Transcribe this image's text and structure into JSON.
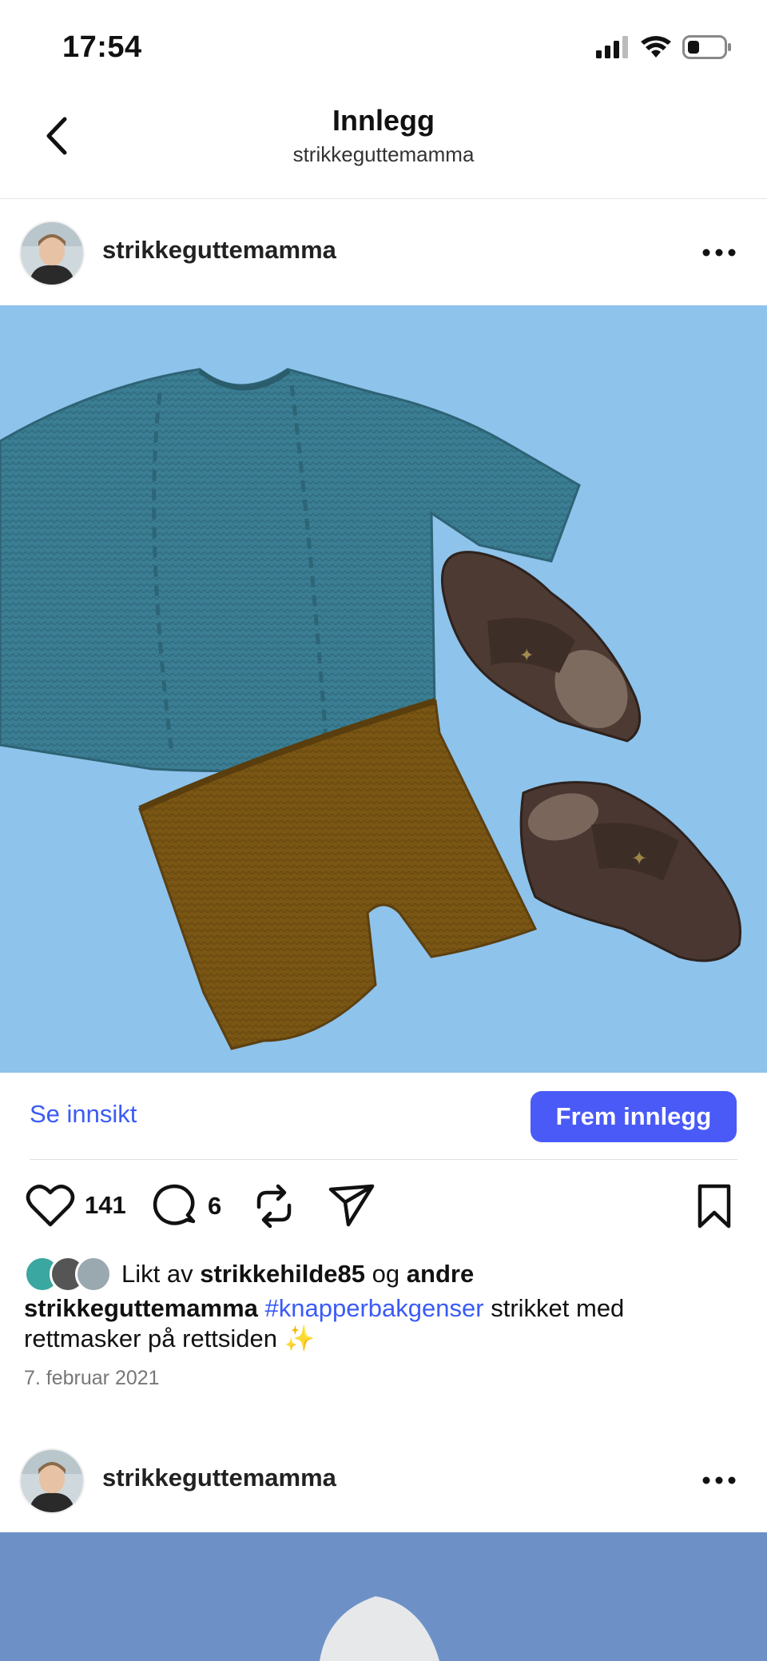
{
  "status_bar": {
    "time": "17:54"
  },
  "nav": {
    "title": "Innlegg",
    "subtitle": "strikkeguttemamma"
  },
  "post": {
    "username": "strikkeguttemamma",
    "insights_label": "Se innsikt",
    "promote_label": "Frem innlegg",
    "like_count": "141",
    "comment_count": "6",
    "liked_by_prefix": "Likt av",
    "liked_by_user": "strikkehilde85",
    "liked_by_joiner": "og",
    "liked_by_others": "andre",
    "caption_user": "strikkeguttemamma",
    "caption_hashtag": "#knapperbakgenser",
    "caption_text": "strikket med rettmasker på rettsiden ✨",
    "date": "7. februar 2021"
  },
  "next_post": {
    "username": "strikkeguttemamma"
  },
  "icons": {
    "back": "chevron-left-icon",
    "more": "more-horizontal-icon",
    "like": "heart-icon",
    "comment": "comment-icon",
    "repost": "repost-icon",
    "share": "send-icon",
    "save": "bookmark-icon"
  },
  "colors": {
    "accent": "#4a5af7",
    "link": "#3b5bf5",
    "photo_bg": "#8ec3ec"
  }
}
